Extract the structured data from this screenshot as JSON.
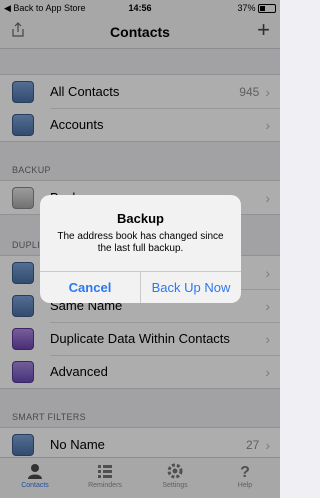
{
  "status": {
    "carrier": "◀ Back to App Store",
    "time": "14:56",
    "battery": "37%"
  },
  "nav": {
    "title": "Contacts"
  },
  "group1": [
    {
      "label": "All Contacts",
      "value": "945"
    },
    {
      "label": "Accounts",
      "value": ""
    }
  ],
  "sections": {
    "backup": "BACKUP",
    "duplicates": "DUPLI",
    "smart": "SMART FILTERS"
  },
  "backup_row": {
    "label": "Backup"
  },
  "dup_rows": [
    {
      "label": ""
    },
    {
      "label": "Same Name"
    },
    {
      "label": "Duplicate Data Within Contacts"
    },
    {
      "label": "Advanced"
    }
  ],
  "smart_row": {
    "label": "No Name",
    "value": "27"
  },
  "tabs": [
    "Contacts",
    "Reminders",
    "Settings",
    "Help"
  ],
  "alert": {
    "title": "Backup",
    "message": "The address book has changed since the last full backup.",
    "cancel": "Cancel",
    "confirm": "Back Up Now"
  },
  "colors": {
    "accent": "#2d78f0"
  }
}
